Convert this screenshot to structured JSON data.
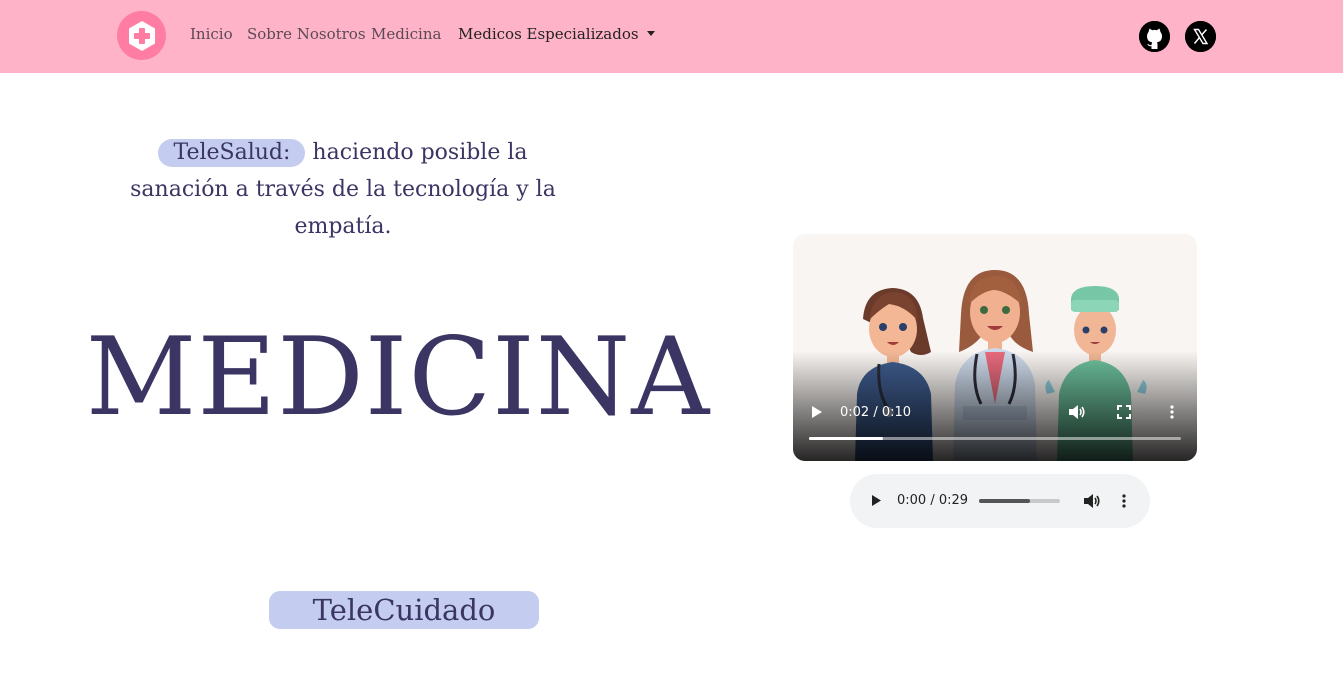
{
  "nav": {
    "links": [
      "Inicio",
      "Sobre Nosotros",
      "Medicina"
    ],
    "dropdown_label": "Medicos Especializados",
    "logo_icon": "medical-cross-icon",
    "social_icons": [
      "github-icon",
      "x-icon"
    ]
  },
  "hero": {
    "badge": "TeleSalud:",
    "tagline_line1": "haciendo posible la",
    "tagline_line2": "sanación a través de la tecnología y la",
    "tagline_line3": "empatía.",
    "title": "MEDICINA"
  },
  "section": {
    "telecuidado": "TeleCuidado"
  },
  "video": {
    "time": "0:02 / 0:10",
    "progress": 0.2
  },
  "audio": {
    "time": "0:00 / 0:29",
    "volume": 0.63
  },
  "colors": {
    "navbar": "#ffb3c8",
    "accent_pill": "#c4cdf0",
    "text": "#3a3563",
    "logo": "#ff7da3"
  }
}
